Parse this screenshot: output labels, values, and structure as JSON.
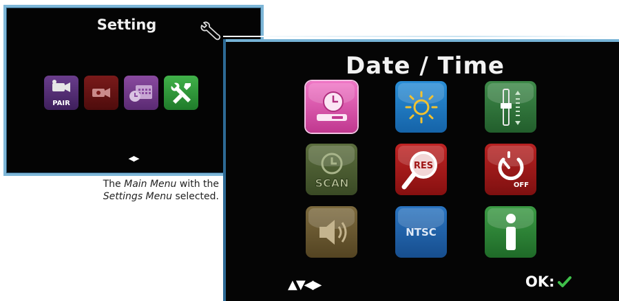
{
  "main_menu": {
    "title": "Setting",
    "icons": [
      {
        "name": "pair-icon",
        "label": "PAIR"
      },
      {
        "name": "camera-icon"
      },
      {
        "name": "calendar-icon"
      },
      {
        "name": "wrench-icon"
      }
    ],
    "nav_arrows": "◀▶"
  },
  "caption": {
    "line1_pre": "The ",
    "line1_em": "Main Menu",
    "line1_post": " with the",
    "line2_em": "Settings Menu",
    "line2_post": " selected."
  },
  "date_time_menu": {
    "title": "Date / Time",
    "icons": [
      {
        "name": "date-time-icon"
      },
      {
        "name": "brightness-icon"
      },
      {
        "name": "volume-slider-icon"
      },
      {
        "name": "scan-icon",
        "label": "SCAN"
      },
      {
        "name": "resolution-icon",
        "label": "RES"
      },
      {
        "name": "auto-off-icon",
        "label": "OFF"
      },
      {
        "name": "speaker-icon"
      },
      {
        "name": "ntsc-icon",
        "label": "NTSC"
      },
      {
        "name": "info-icon"
      }
    ],
    "nav_arrows": "▲▼◀▶",
    "ok_label": "OK:",
    "ok_color": "#3fbf4a"
  },
  "colors": {
    "screen_border": "#7eb7d8",
    "selected_icon": "#f076c6"
  }
}
